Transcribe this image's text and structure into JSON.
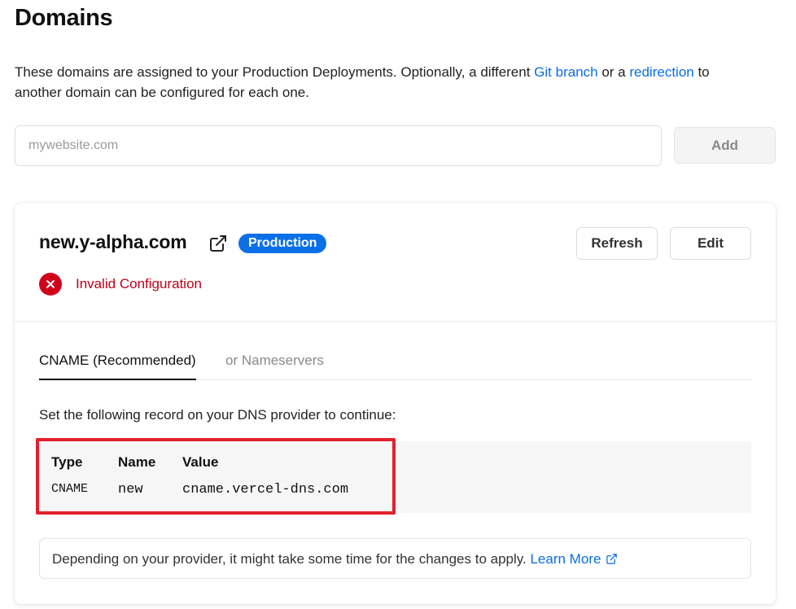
{
  "page": {
    "title": "Domains",
    "intro": {
      "text_before": "These domains are assigned to your Production Deployments. Optionally, a different ",
      "git_branch_link": "Git branch",
      "text_middle": " or a ",
      "redirection_link": "redirection",
      "text_after": " to another domain can be configured for each one."
    }
  },
  "add_domain": {
    "placeholder": "mywebsite.com",
    "value": "",
    "button_label": "Add"
  },
  "domain_card": {
    "domain": "new.y-alpha.com",
    "badge": "Production",
    "refresh_label": "Refresh",
    "edit_label": "Edit",
    "status_text": "Invalid Configuration",
    "tabs": [
      {
        "label": "CNAME (Recommended)",
        "active": true
      },
      {
        "label": "or Nameservers",
        "active": false
      }
    ],
    "instructions": "Set the following record on your DNS provider to continue:",
    "record": {
      "headers": {
        "type": "Type",
        "name": "Name",
        "value": "Value"
      },
      "type": "CNAME",
      "name": "new",
      "value": "cname.vercel-dns.com"
    },
    "notice": {
      "text": "Depending on your provider, it might take some time for the changes to apply. ",
      "link": "Learn More"
    }
  },
  "icons": {
    "external_link": "external-link-icon",
    "error": "error-x-icon"
  },
  "colors": {
    "link": "#0a6ee6",
    "badge_bg": "#0b70e8",
    "error": "#d0021b",
    "highlight_border": "#e2202c"
  }
}
